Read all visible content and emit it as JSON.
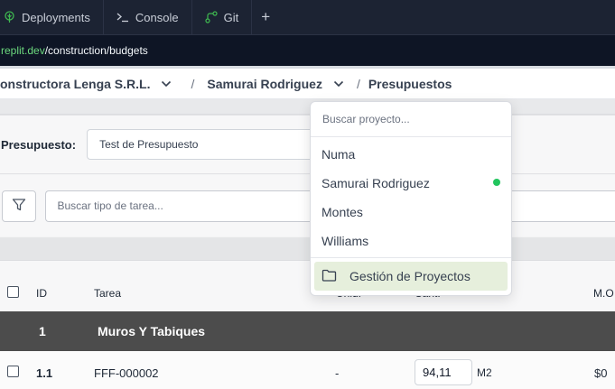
{
  "tabs": [
    {
      "label": "Deployments",
      "icon": "deployments-icon"
    },
    {
      "label": "Console",
      "icon": "console-icon"
    },
    {
      "label": "Git",
      "icon": "git-icon"
    }
  ],
  "url": {
    "host": "replit.dev",
    "path": "/construction/budgets"
  },
  "breadcrumb": {
    "company": "onstructora Lenga S.R.L.",
    "separator": "/",
    "project": "Samurai Rodriguez",
    "page": "Presupuestos"
  },
  "budget": {
    "label": "Presupuesto:",
    "selected": "Test de Presupuesto"
  },
  "filters": {
    "search_placeholder": "Buscar tipo de tarea..."
  },
  "table": {
    "headers": {
      "id": "ID",
      "task": "Tarea",
      "unit": "Unid.",
      "qty": "Cant.",
      "mo": "M.O"
    },
    "group": {
      "id": "1",
      "name": "Muros Y Tabiques"
    },
    "rows": [
      {
        "id": "1.1",
        "code": "FFF-000002",
        "unit": "-",
        "qty": "94,11",
        "qty_unit": "M2",
        "mo": "$0"
      }
    ]
  },
  "project_dropdown": {
    "search_placeholder": "Buscar proyecto...",
    "projects": [
      {
        "name": "Numa",
        "active": false
      },
      {
        "name": "Samurai Rodriguez",
        "active": true
      },
      {
        "name": "Montes",
        "active": false
      },
      {
        "name": "Williams",
        "active": false
      }
    ],
    "manage_label": "Gestión de Proyectos"
  },
  "colors": {
    "accent_green": "#22c55e",
    "url_host": "#6cd97e",
    "group_row_bg": "#4c4c4c",
    "highlight_bg": "#e6efdc"
  }
}
